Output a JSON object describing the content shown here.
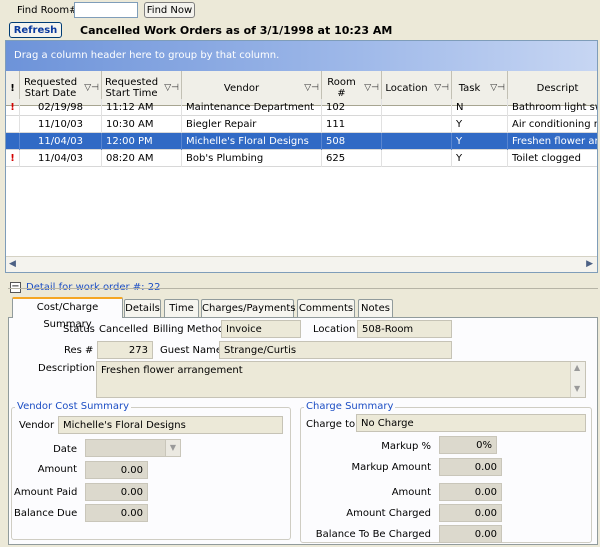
{
  "toolbar": {
    "find_room_label": "Find Room#",
    "find_room_value": "",
    "find_now_label": "Find Now",
    "refresh_label": "Refresh",
    "heading": "Cancelled Work Orders as of 3/1/1998 at 10:23 AM"
  },
  "grid": {
    "group_hint": "Drag a column header here to group by that column.",
    "columns": [
      {
        "label": "!"
      },
      {
        "label": "Requested Start Date"
      },
      {
        "label": "Requested Start Time"
      },
      {
        "label": "Vendor"
      },
      {
        "label": "Room #"
      },
      {
        "label": "Location"
      },
      {
        "label": "Task"
      },
      {
        "label": "Descript"
      }
    ],
    "rows": [
      {
        "flag": "!",
        "date": "02/19/98",
        "time": "11:12 AM",
        "vendor": "Maintenance Department",
        "room": "102",
        "location": "",
        "task": "N",
        "desc": "Bathroom light switch",
        "selected": false
      },
      {
        "flag": "",
        "date": "11/10/03",
        "time": "10:30 AM",
        "vendor": "Biegler Repair",
        "room": "111",
        "location": "",
        "task": "Y",
        "desc": "Air conditioning making",
        "selected": false
      },
      {
        "flag": "",
        "date": "11/04/03",
        "time": "12:00 PM",
        "vendor": "Michelle's Floral Designs",
        "room": "508",
        "location": "",
        "task": "Y",
        "desc": "Freshen flower arrang",
        "selected": true
      },
      {
        "flag": "!",
        "date": "11/04/03",
        "time": "08:20 AM",
        "vendor": "Bob's Plumbing",
        "room": "625",
        "location": "",
        "task": "Y",
        "desc": "Toilet clogged",
        "selected": false
      }
    ]
  },
  "detail": {
    "title": "Detail for work order #: 22",
    "tabs": [
      "Cost/Charge Summary",
      "Details",
      "Time",
      "Charges/Payments",
      "Comments",
      "Notes"
    ],
    "status_label": "Status",
    "status_value": "Cancelled",
    "billing_label": "Billing Method",
    "billing_value": "Invoice",
    "location_label": "Location",
    "location_value": "508-Room",
    "res_label": "Res #",
    "res_value": "273",
    "guest_label": "Guest Name",
    "guest_value": "Strange/Curtis",
    "description_label": "Description",
    "description_value": "Freshen flower arrangement"
  },
  "vendor_cost": {
    "title": "Vendor Cost Summary",
    "vendor_label": "Vendor",
    "vendor_value": "Michelle's Floral Designs",
    "date_label": "Date",
    "date_value": "",
    "amount_label": "Amount",
    "amount_value": "0.00",
    "amount_paid_label": "Amount Paid",
    "amount_paid_value": "0.00",
    "balance_due_label": "Balance Due",
    "balance_due_value": "0.00"
  },
  "charge_summary": {
    "title": "Charge Summary",
    "charge_to_label": "Charge to",
    "charge_to_value": "No Charge",
    "markup_pct_label": "Markup %",
    "markup_pct_value": "0%",
    "markup_amount_label": "Markup Amount",
    "markup_amount_value": "0.00",
    "amount_label": "Amount",
    "amount_value": "0.00",
    "amount_charged_label": "Amount Charged",
    "amount_charged_value": "0.00",
    "balance_to_charge_label": "Balance To Be Charged",
    "balance_to_charge_value": "0.00"
  }
}
